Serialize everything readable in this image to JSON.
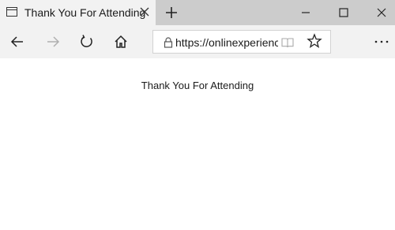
{
  "tab": {
    "title": "Thank You For Attending",
    "icon": "page-icon"
  },
  "address_bar": {
    "url": "https://onlinexperience"
  },
  "page": {
    "heading": "Thank You For Attending"
  },
  "icons": {
    "tab_close": "close-icon",
    "new_tab": "plus-icon",
    "minimize": "minimize-icon",
    "maximize": "maximize-icon",
    "close_window": "close-icon",
    "back": "back-arrow-icon",
    "forward": "forward-arrow-icon",
    "refresh": "refresh-icon",
    "home": "home-icon",
    "lock": "lock-icon",
    "reading_view": "book-icon",
    "favorite": "star-icon",
    "more": "ellipsis-icon"
  },
  "colors": {
    "titlebar": "#cccccc",
    "tab_active": "#f2f2f2",
    "toolbar": "#f2f2f2",
    "content": "#ffffff"
  }
}
